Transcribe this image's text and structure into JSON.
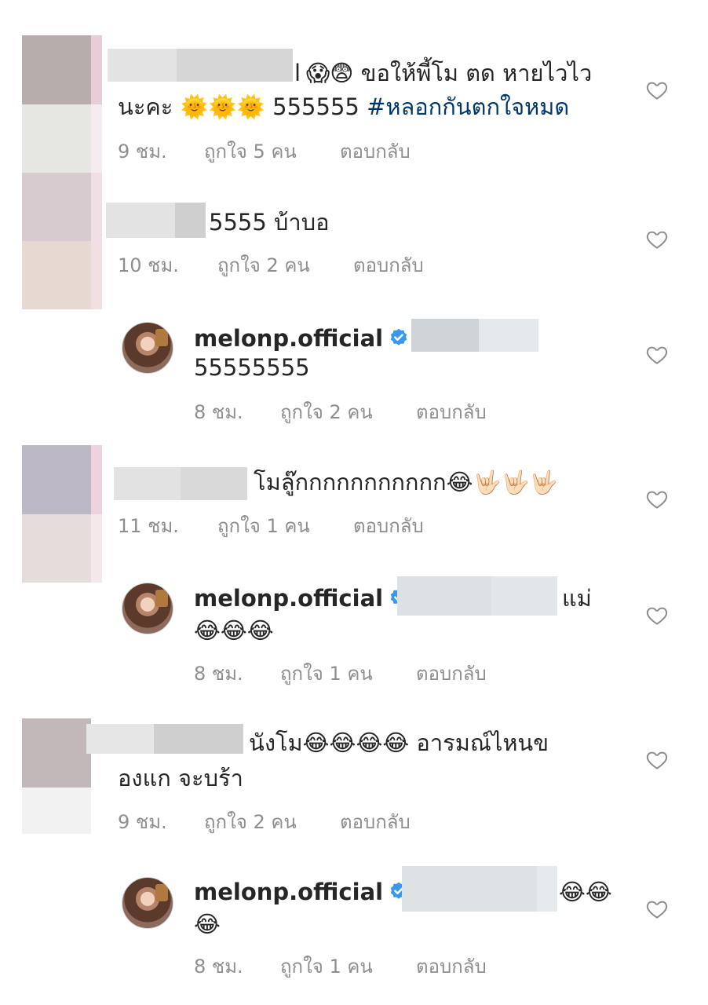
{
  "actions": {
    "reply_label": "ตอบกลับ"
  },
  "comments": [
    {
      "text_line1_end": "l",
      "text_line1_main": "😱😨 ขอให้พี้โม ตด หายไวไว",
      "text_line2_main": "นะคะ 🌞🌞🌞 555555",
      "hashtag": "#หลอกกันตกใจหมด",
      "time": "9 ชม.",
      "likes": "ถูกใจ 5 คน"
    },
    {
      "text": "5555 บ้าบอ",
      "time": "10 ชม.",
      "likes": "ถูกใจ 2 คน"
    },
    {
      "username": "melonp.official",
      "mention_prefix": "@",
      "text": "55555555",
      "time": "8 ชม.",
      "likes": "ถูกใจ 2 คน"
    },
    {
      "text": "โมลู๊กกกกกกกกกกก😂🤟🏻🤟🏻🤟🏻",
      "time": "11 ชม.",
      "likes": "ถูกใจ 1 คน"
    },
    {
      "username": "melonp.official",
      "text_end": "แม่",
      "text_line2": "😂😂😂",
      "time": "8 ชม.",
      "likes": "ถูกใจ 1 คน"
    },
    {
      "text_line1": "นังโม😂😂😂😂 อารมณ์ไหนข",
      "text_line2": "องแก จะบร้า",
      "time": "9 ชม.",
      "likes": "ถูกใจ 2 คน"
    },
    {
      "username": "melonp.official",
      "text_end": "😂😂",
      "text_line2": "😂",
      "time": "8 ชม.",
      "likes": "ถูกใจ 1 คน"
    }
  ],
  "colors": {
    "text": "#262626",
    "meta": "#8e8e8e",
    "hashtag": "#00376b",
    "verified": "#3897f0"
  },
  "icons": {
    "heart": "heart-outline-icon",
    "verified": "verified-badge-icon"
  }
}
